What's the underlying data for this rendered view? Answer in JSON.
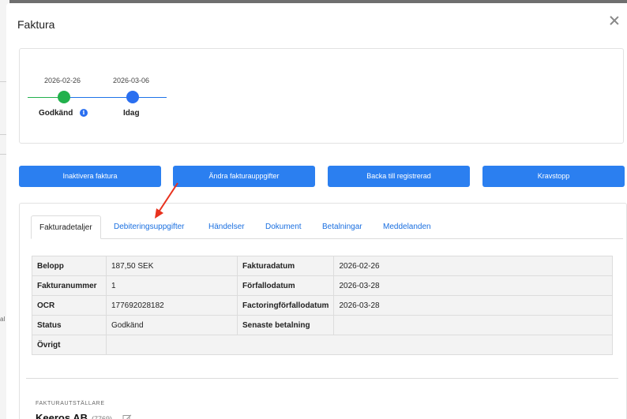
{
  "background": {
    "fragment": "al"
  },
  "modal": {
    "title": "Faktura"
  },
  "timeline": {
    "steps": [
      {
        "date": "2026-02-26",
        "label": "Godkänd",
        "status_color": "#22b14c"
      },
      {
        "date": "2026-03-06",
        "label": "Idag",
        "status_color": "#2a6ff0"
      }
    ],
    "info_glyph": "i"
  },
  "actions": {
    "deactivate": "Inaktivera faktura",
    "edit": "Ändra fakturauppgifter",
    "revert": "Backa till registrerad",
    "hold": "Kravstopp"
  },
  "tabs": [
    "Fakturadetaljer",
    "Debiteringsuppgifter",
    "Händelser",
    "Dokument",
    "Betalningar",
    "Meddelanden"
  ],
  "details": {
    "rows": [
      {
        "k1": "Belopp",
        "v1": "187,50 SEK",
        "k2": "Fakturadatum",
        "v2": "2026-02-26"
      },
      {
        "k1": "Fakturanummer",
        "v1": "1",
        "k2": "Förfallodatum",
        "v2": "2026-03-28"
      },
      {
        "k1": "OCR",
        "v1": "177692028182",
        "k2": "Factoringförfallodatum",
        "v2": "2026-03-28"
      },
      {
        "k1": "Status",
        "v1": "Godkänd",
        "k2": "Senaste betalning",
        "v2": ""
      },
      {
        "k1": "Övrigt",
        "v1": "",
        "k2": "",
        "v2": ""
      }
    ]
  },
  "issuer": {
    "caption": "FAKTURAUTSTÄLLARE",
    "name": "Keeros AB",
    "id": "(7769)"
  },
  "colors": {
    "accent": "#2b7ff0",
    "success": "#22b14c",
    "annotation_arrow": "#e8321e"
  }
}
